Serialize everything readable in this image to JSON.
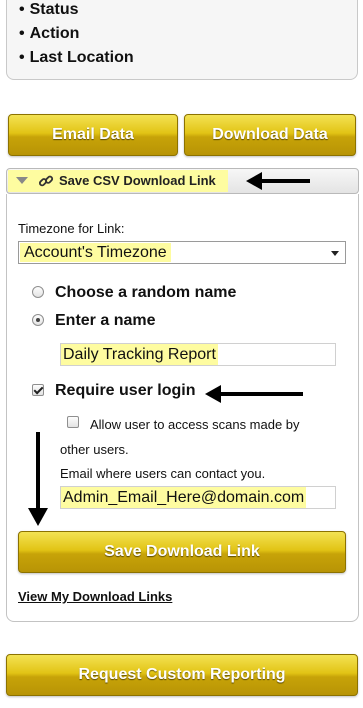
{
  "top_list": {
    "items": [
      "Status",
      "Action",
      "Last Location"
    ]
  },
  "buttons": {
    "email": "Email Data",
    "download": "Download Data",
    "save_link": "Save Download Link",
    "request_custom": "Request Custom Reporting"
  },
  "section": {
    "title": "Save CSV Download Link",
    "icon": "link-icon"
  },
  "form": {
    "timezone_label": "Timezone for Link:",
    "timezone_value": "Account's Timezone",
    "radio_random": "Choose a random name",
    "radio_enter": "Enter a name",
    "name_value": "Daily Tracking Report",
    "require_login": "Require user login",
    "allow_scans_line1": "Allow user to access scans made by",
    "allow_scans_line2": "other users.",
    "email_label": "Email where users can contact you.",
    "email_value": "Admin_Email_Here@domain.com",
    "view_links": "View My Download Links"
  },
  "colors": {
    "highlight": "#fefca0",
    "gold_top": "#f3e253",
    "gold_bottom": "#b89405"
  }
}
